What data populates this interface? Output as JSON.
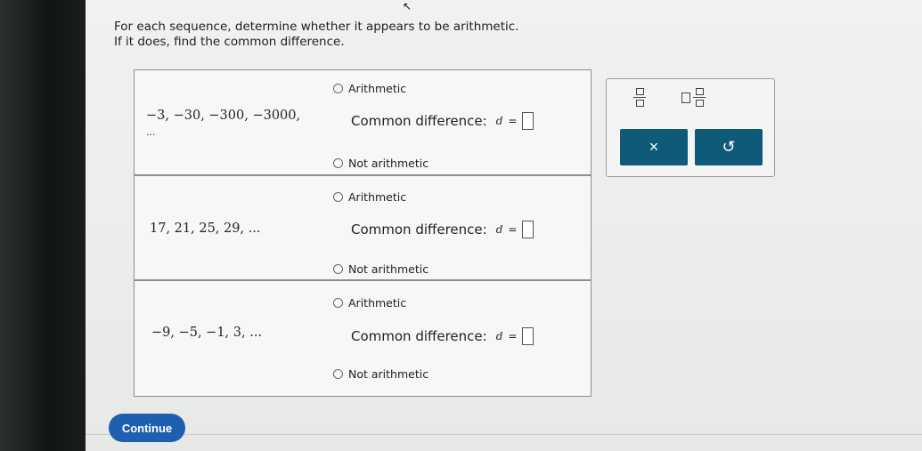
{
  "instructions": {
    "line1": "For each sequence, determine whether it appears to be arithmetic.",
    "line2": "If it does, find the common difference."
  },
  "rows": [
    {
      "sequence": "−3, −30, −300, −3000,",
      "sequence_cont": "...",
      "opt_arith": "Arithmetic",
      "common_diff_label": "Common difference:",
      "d_var": "d",
      "eq": "=",
      "opt_not": "Not arithmetic"
    },
    {
      "sequence": "17, 21, 25, 29, ...",
      "sequence_cont": "",
      "opt_arith": "Arithmetic",
      "common_diff_label": "Common difference:",
      "d_var": "d",
      "eq": "=",
      "opt_not": "Not arithmetic"
    },
    {
      "sequence": "−9, −5, −1, 3, ...",
      "sequence_cont": "",
      "opt_arith": "Arithmetic",
      "common_diff_label": "Common difference:",
      "d_var": "d",
      "eq": "=",
      "opt_not": "Not arithmetic"
    }
  ],
  "toolbox": {
    "clear_symbol": "×",
    "undo_symbol": "↺"
  },
  "continue_label": "Continue",
  "colors": {
    "tool_button": "#0f5a78",
    "continue_button": "#1f5fb0"
  }
}
